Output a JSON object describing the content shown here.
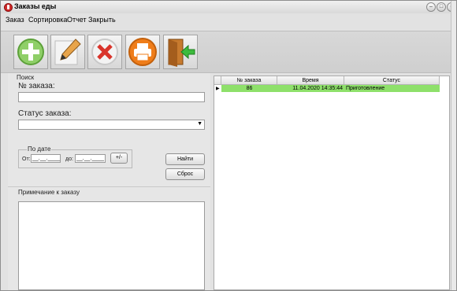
{
  "window": {
    "title": "Заказы еды"
  },
  "menu": [
    "Заказ",
    "Сортировка",
    "Отчет",
    "Закрыть"
  ],
  "toolbar": [
    {
      "name": "add-button",
      "icon": "plus-icon"
    },
    {
      "name": "edit-button",
      "icon": "pencil-icon"
    },
    {
      "name": "delete-button",
      "icon": "close-icon"
    },
    {
      "name": "print-button",
      "icon": "printer-icon"
    },
    {
      "name": "exit-button",
      "icon": "exit-door-icon"
    }
  ],
  "search": {
    "group_title": "Поиск",
    "order_no_label": "№ заказа:",
    "order_no_value": "",
    "status_label": "Статус заказа:",
    "status_value": "",
    "date_group_title": "По дате",
    "from_label": "От:",
    "from_value": "__.__.____",
    "to_label": "до:",
    "to_value": "__.__.____",
    "plusminus_label": "+/-",
    "find_label": "Найти",
    "reset_label": "Сброс"
  },
  "note": {
    "title": "Примечание к заказу",
    "text": ""
  },
  "orders": {
    "columns": [
      "№ заказа",
      "Время",
      "Статус"
    ],
    "rows": [
      {
        "id": "86",
        "time": "11.04.2020 14:35:44",
        "status": "Приготовление"
      }
    ],
    "row_color": "#8ee06a"
  }
}
